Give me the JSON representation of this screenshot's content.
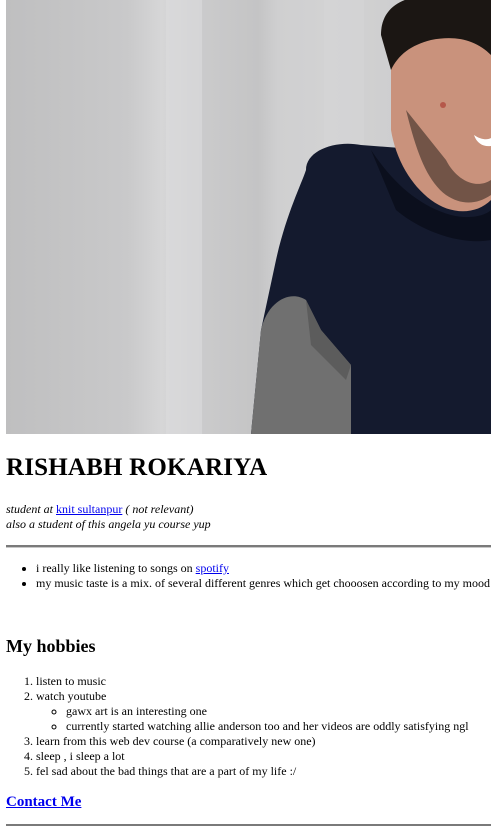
{
  "profile": {
    "name": "RISHABH ROKARIYA",
    "tagline_prefix": "student at ",
    "college_link": "knit sultanpur",
    "tagline_suffix": " ( not relevant)",
    "tagline_line2": "also a student of this angela yu course yup"
  },
  "music": {
    "items": [
      {
        "prefix": "i really like listening to songs on ",
        "link": "spotify"
      },
      {
        "text": "my music taste is a mix. of several different genres which get chooosen according to my mood"
      }
    ]
  },
  "hobbies": {
    "title": "My hobbies",
    "items": [
      "listen to music",
      "watch youtube",
      "learn from this web dev course (a comparatively new one)",
      "sleep , i sleep a lot",
      "fel sad about the bad things that are a part of my life :/"
    ],
    "youtube_sub": [
      "gawx art is an interesting one",
      "currently started watching allie anderson too and her videos are oddly satisfying ngl"
    ]
  },
  "contact": {
    "label": "Contact Me"
  },
  "photo": {
    "subject": "profile-photo",
    "colors": {
      "wall": "#cbcbcc",
      "hoodie": "#141a2e",
      "sleeve": "#707070",
      "hair": "#1b1613",
      "skin": "#c9927c"
    }
  }
}
